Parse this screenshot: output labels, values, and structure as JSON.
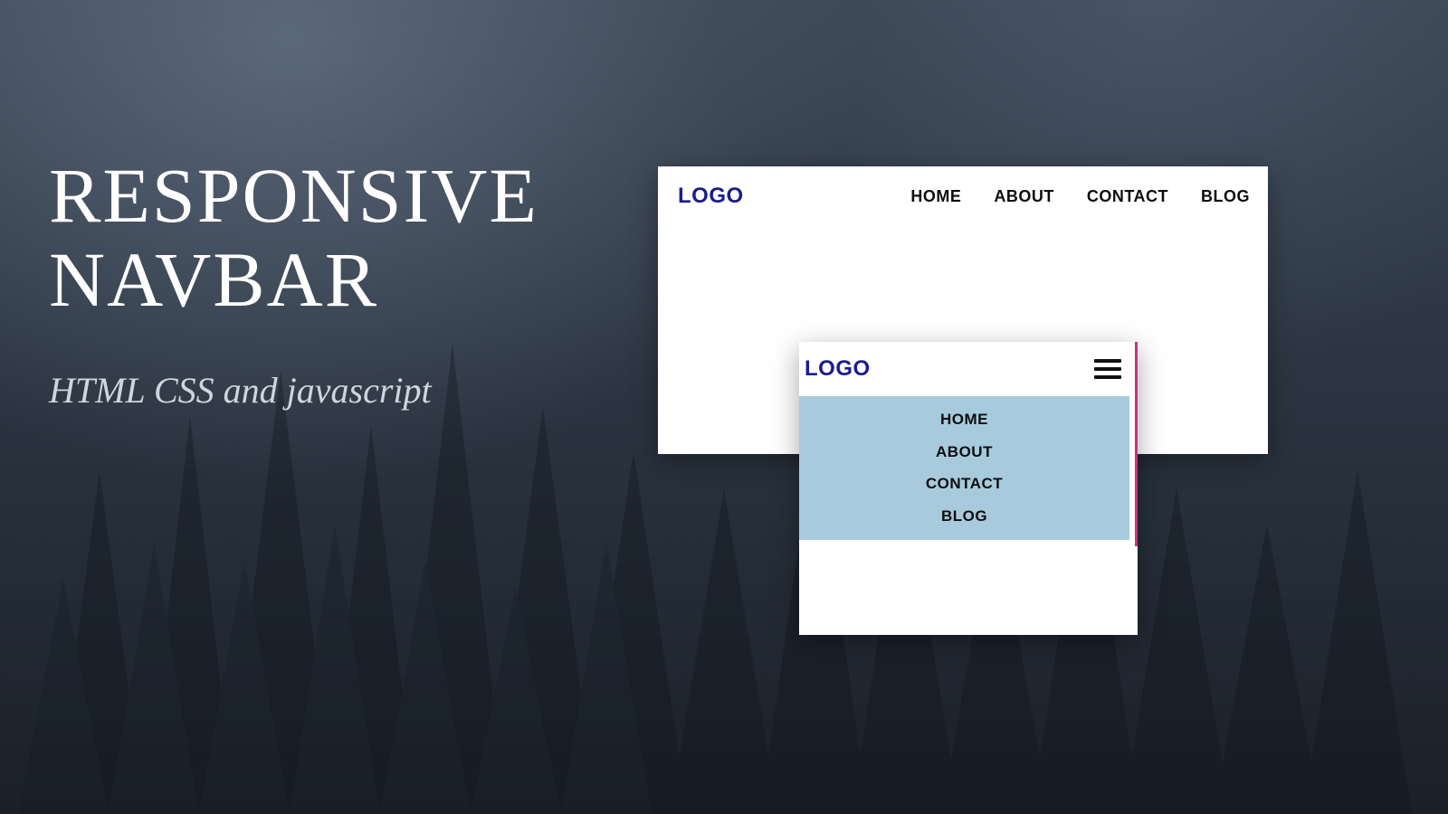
{
  "hero": {
    "title_line1": "RESPONSIVE",
    "title_line2": "NAVBAR",
    "subtitle": "HTML CSS and javascript"
  },
  "desktop": {
    "logo": "LOGO",
    "links": [
      "HOME",
      "ABOUT",
      "CONTACT",
      "BLOG"
    ]
  },
  "mobile": {
    "logo": "LOGO",
    "hamburger_icon": "hamburger-icon",
    "links": [
      "HOME",
      "ABOUT",
      "CONTACT",
      "BLOG"
    ]
  },
  "colors": {
    "logo": "#1a1d8c",
    "mobile_menu_bg": "#a7cbdc",
    "accent": "#c01f6f"
  }
}
